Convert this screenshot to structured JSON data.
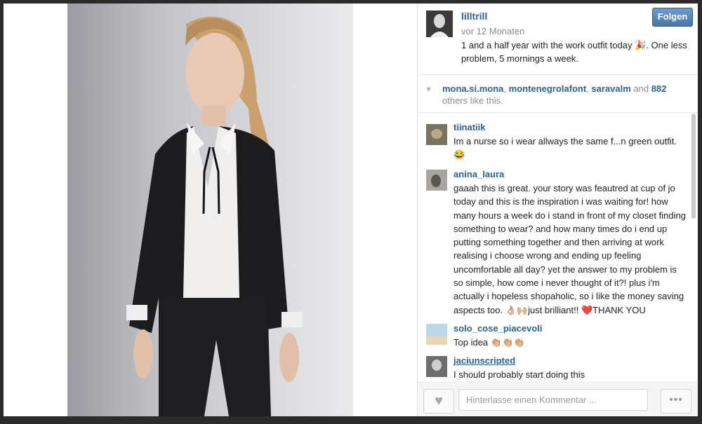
{
  "post": {
    "username": "lilltrill",
    "time": "vor 12 Monaten",
    "caption": "1 and a half year with the work outfit today 🎉. One less problem, 5 mornings a week.",
    "follow_label": "Folgen"
  },
  "likes": {
    "users": [
      "mona.si.mona",
      "montenegrolafont",
      "saravalm"
    ],
    "sep1": ", ",
    "sep2": ", ",
    "and_text": " and ",
    "count": "882",
    "suffix": " others like this."
  },
  "comments": [
    {
      "user": "tiinatiik",
      "text": "Im a nurse so i wear allways the same f...n green outfit. 😂"
    },
    {
      "user": "anina_laura",
      "text": "gaaah this is great. your story was feautred at cup of jo today and this is the inspiration i was waiting for! how many hours a week do i stand in front of my closet finding something to wear? and how many times do i end up putting something together and then arriving at work realising i choose wrong and ending up feeling uncomfortable all day? yet the answer to my problem is so simple, how come i never thought of it?! plus i'm actually i hopeless shopaholic, so i like the money saving aspects too. 👌🏼🙌🏼just brilliant!! ❤️THANK YOU"
    },
    {
      "user": "solo_cose_piacevoli",
      "text": "Top idea 👏🏼👏🏼👏🏼"
    },
    {
      "user": "jaciunscripted",
      "text": "I should probably start doing this"
    }
  ],
  "bottom": {
    "comment_placeholder": "Hinterlasse einen Kommentar ...",
    "more_label": "•••"
  },
  "icons": {
    "heart": "heart-icon",
    "more": "more-options-icon"
  },
  "colors": {
    "link": "#2f6290",
    "follow_button": "#4f7fb0"
  }
}
